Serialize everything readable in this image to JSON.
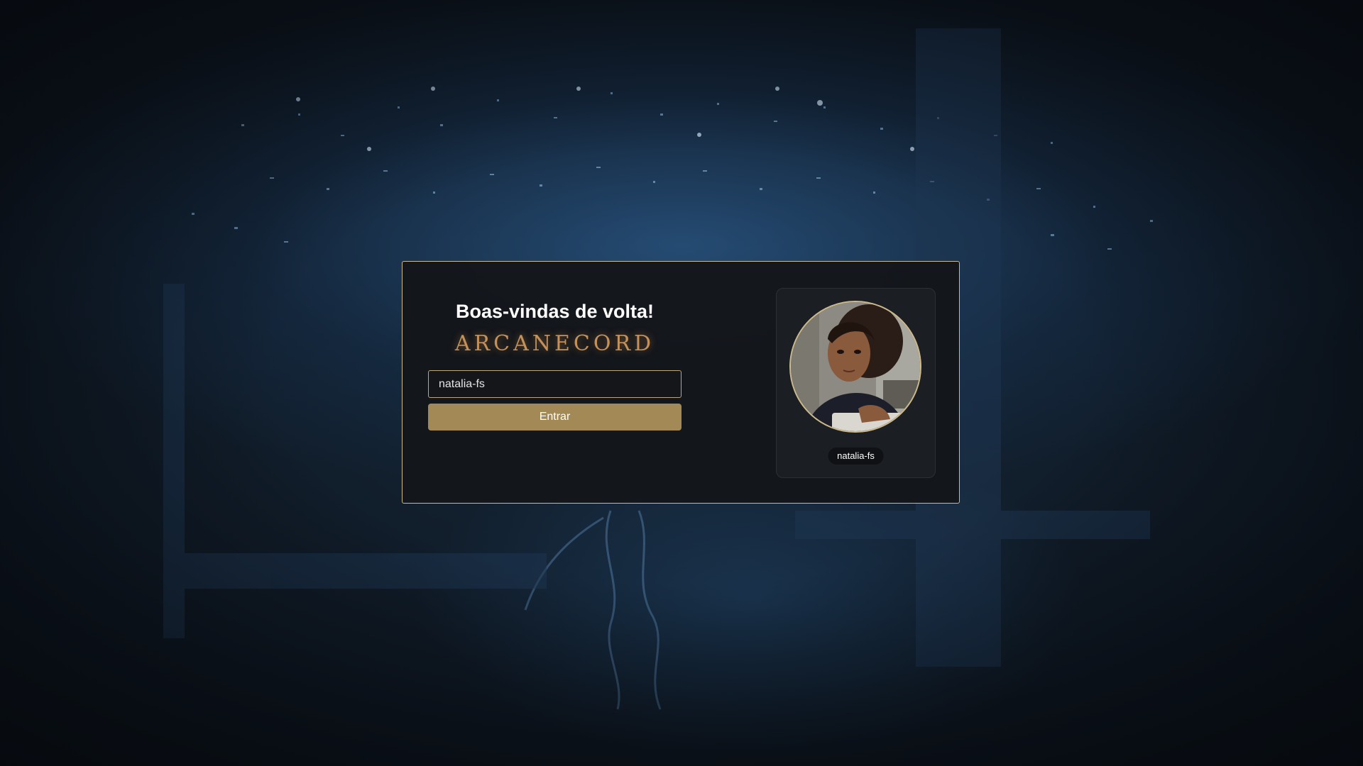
{
  "login": {
    "title": "Boas-vindas de volta!",
    "brand": "ARCANECORD",
    "username_value": "natalia-fs",
    "submit_label": "Entrar"
  },
  "profile": {
    "username": "natalia-fs"
  },
  "colors": {
    "accent_gold": "#a38955",
    "border_gold": "#cdb98a",
    "brand_copper": "#c4915a",
    "card_bg": "#141619"
  }
}
